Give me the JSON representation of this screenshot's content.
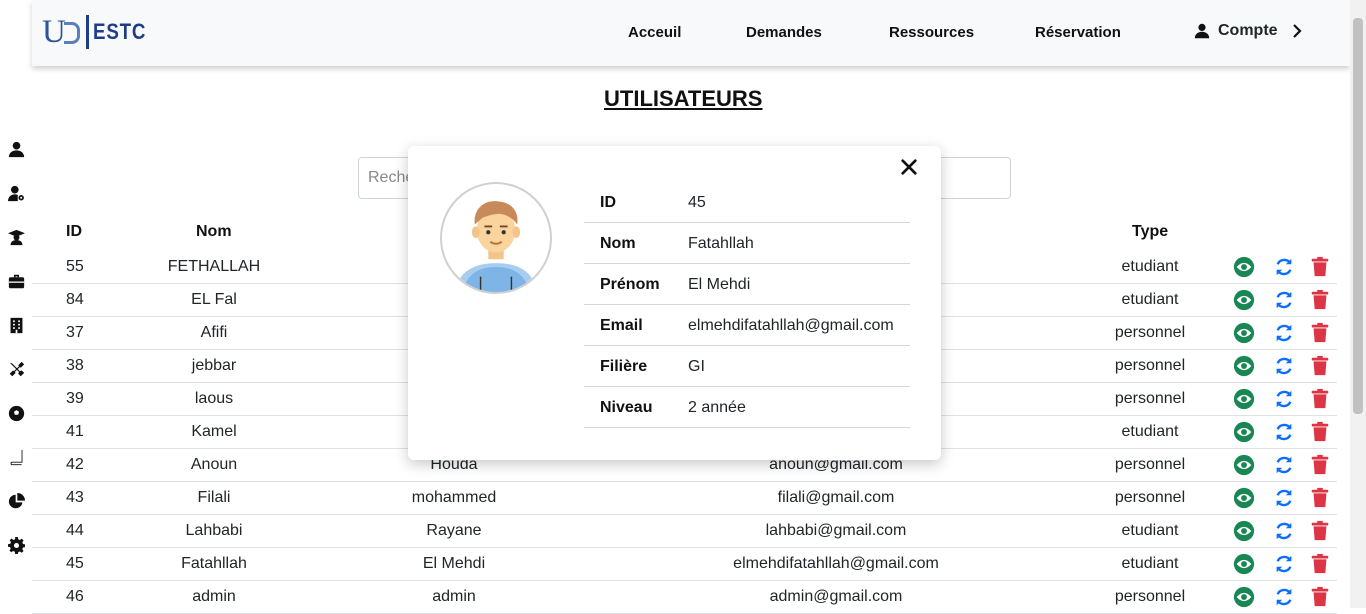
{
  "header": {
    "logo_mark": "U",
    "logo_text": "ESTC",
    "nav": [
      "Acceuil",
      "Demandes",
      "Ressources",
      "Réservation"
    ],
    "account_label": "Compte"
  },
  "sidebar": {
    "icons": [
      "user-icon",
      "user-gear-icon",
      "graduate-icon",
      "briefcase-icon",
      "building-icon",
      "tools-icon",
      "soccer-ball-icon",
      "book-icon",
      "pie-chart-icon",
      "gear-icon"
    ]
  },
  "page": {
    "title": "UTILISATEURS",
    "search_placeholder": "Rechercher"
  },
  "table": {
    "headers": {
      "id": "ID",
      "nom": "Nom",
      "type": "Type"
    },
    "rows": [
      {
        "id": "55",
        "nom": "FETHALLAH",
        "prenom": "",
        "email": "",
        "type": "etudiant"
      },
      {
        "id": "84",
        "nom": "EL Fal",
        "prenom": "",
        "email": "",
        "type": "etudiant"
      },
      {
        "id": "37",
        "nom": "Afifi",
        "prenom": "",
        "email": "",
        "type": "personnel"
      },
      {
        "id": "38",
        "nom": "jebbar",
        "prenom": "",
        "email": "",
        "type": "personnel"
      },
      {
        "id": "39",
        "nom": "laous",
        "prenom": "",
        "email": "",
        "type": "personnel"
      },
      {
        "id": "41",
        "nom": "Kamel",
        "prenom": "",
        "email": "",
        "type": "etudiant"
      },
      {
        "id": "42",
        "nom": "Anoun",
        "prenom": "Houda",
        "email": "anoun@gmail.com",
        "type": "personnel"
      },
      {
        "id": "43",
        "nom": "Filali",
        "prenom": "mohammed",
        "email": "filali@gmail.com",
        "type": "personnel"
      },
      {
        "id": "44",
        "nom": "Lahbabi",
        "prenom": "Rayane",
        "email": "lahbabi@gmail.com",
        "type": "etudiant"
      },
      {
        "id": "45",
        "nom": "Fatahllah",
        "prenom": "El Mehdi",
        "email": "elmehdifatahllah@gmail.com",
        "type": "etudiant"
      },
      {
        "id": "46",
        "nom": "admin",
        "prenom": "admin",
        "email": "admin@gmail.com",
        "type": "personnel"
      }
    ]
  },
  "modal": {
    "fields": [
      {
        "label": "ID",
        "value": "45"
      },
      {
        "label": "Nom",
        "value": "Fatahllah"
      },
      {
        "label": "Prénom",
        "value": "El Mehdi"
      },
      {
        "label": "Email",
        "value": "elmehdifatahllah@gmail.com"
      },
      {
        "label": "Filière",
        "value": "GI"
      },
      {
        "label": "Niveau",
        "value": "2 année"
      }
    ]
  },
  "colors": {
    "view": "#198754",
    "update": "#0d6efd",
    "delete": "#dc3545"
  }
}
